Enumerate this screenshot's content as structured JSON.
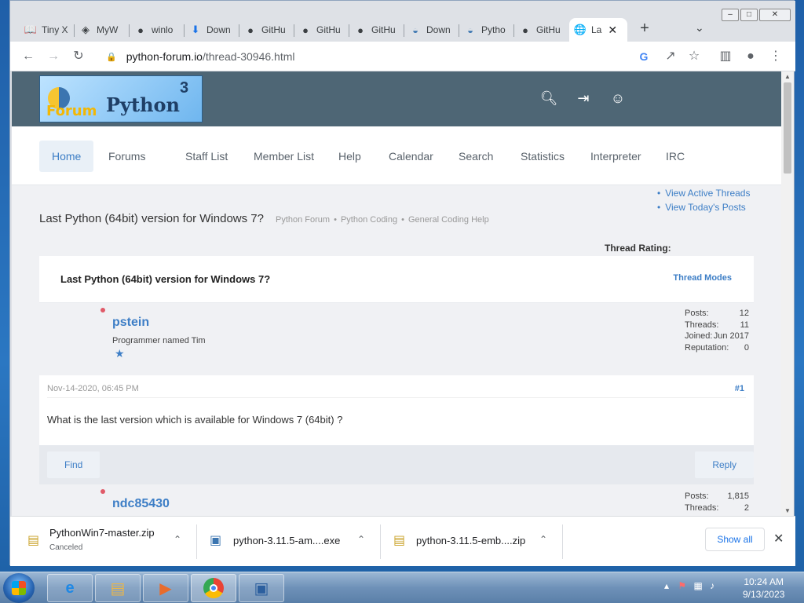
{
  "tabs": [
    {
      "label": "Tiny X",
      "icon": "book-icon"
    },
    {
      "label": "MyW",
      "icon": "app-icon"
    },
    {
      "label": "winlo",
      "icon": "github-icon"
    },
    {
      "label": "Down",
      "icon": "download-icon"
    },
    {
      "label": "GitHu",
      "icon": "github-icon"
    },
    {
      "label": "GitHu",
      "icon": "github-icon"
    },
    {
      "label": "GitHu",
      "icon": "github-icon"
    },
    {
      "label": "Down",
      "icon": "python-icon"
    },
    {
      "label": "Pytho",
      "icon": "python-icon"
    },
    {
      "label": "GitHu",
      "icon": "github-icon"
    },
    {
      "label": "La",
      "icon": "globe-icon",
      "active": true
    }
  ],
  "address_bar": {
    "domain": "python-forum.io",
    "path": "/thread-30946.html"
  },
  "site": {
    "logo_word1": "Forum",
    "logo_word2": "Python",
    "logo_version": "3"
  },
  "nav": [
    "Home",
    "Forums",
    "Staff List",
    "Member List",
    "Help",
    "Calendar",
    "Search",
    "Statistics",
    "Interpreter",
    "IRC"
  ],
  "quick_links": [
    "View Active Threads",
    "View Today's Posts"
  ],
  "thread": {
    "title": "Last Python (64bit) version for Windows 7?",
    "breadcrumb": [
      "Python Forum",
      "Python Coding",
      "General Coding Help"
    ],
    "rating_label": "Thread Rating:",
    "modes_label": "Thread Modes"
  },
  "post1": {
    "author": "pstein",
    "user_title": "Programmer named Tim",
    "stats": [
      {
        "k": "Posts:",
        "v": "12"
      },
      {
        "k": "Threads:",
        "v": "11"
      },
      {
        "k": "Joined:",
        "v": "Jun 2017"
      },
      {
        "k": "Reputation:",
        "v": "0"
      }
    ],
    "date": "Nov-14-2020, 06:45 PM",
    "number": "#1",
    "message": "What is the last version which is available for Windows 7 (64bit) ?",
    "find_label": "Find",
    "reply_label": "Reply"
  },
  "post2": {
    "author": "ndc85430",
    "stats": [
      {
        "k": "Posts:",
        "v": "1,815"
      },
      {
        "k": "Threads:",
        "v": "2"
      }
    ]
  },
  "downloads": [
    {
      "name": "PythonWin7-master.zip",
      "status": "Canceled"
    },
    {
      "name": "python-3.11.5-am....exe",
      "status": ""
    },
    {
      "name": "python-3.11.5-emb....zip",
      "status": ""
    }
  ],
  "downloads_show_all": "Show all",
  "clock": {
    "time": "10:24 AM",
    "date": "9/13/2023"
  }
}
